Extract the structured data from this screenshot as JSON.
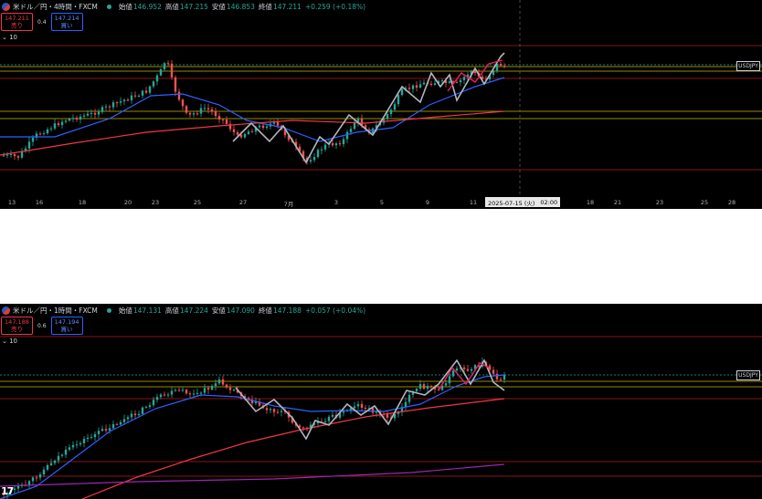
{
  "top": {
    "symbol_title": "米ドル／円・4時間・FXCM",
    "ohlc": [
      {
        "k": "始値",
        "v": "146.952"
      },
      {
        "k": "高値",
        "v": "147.215"
      },
      {
        "k": "安値",
        "v": "146.853"
      },
      {
        "k": "終値",
        "v": "147.211"
      },
      {
        "k": "",
        "v": "+0.259 (+0.18%)"
      }
    ],
    "sell_price": "147.211",
    "sell_label": "売り",
    "spread": "0.4",
    "buy_price": "147.214",
    "buy_label": "買い",
    "indicator_toggle": "⌄ 10",
    "price_tag": "USDJPY",
    "x_labels": [
      "13",
      "16",
      "18",
      "20",
      "23",
      "25",
      "27",
      "7月",
      "3",
      "5",
      "9",
      "11",
      "18",
      "21",
      "23",
      "25",
      "28"
    ],
    "crosshair_date": "2025-07-15 (火)",
    "crosshair_time": "02:00"
  },
  "bottom": {
    "symbol_title": "米ドル／円・1時間・FXCM",
    "ohlc": [
      {
        "k": "始値",
        "v": "147.131"
      },
      {
        "k": "高値",
        "v": "147.224"
      },
      {
        "k": "安値",
        "v": "147.090"
      },
      {
        "k": "終値",
        "v": "147.188"
      },
      {
        "k": "",
        "v": "+0.057 (+0.04%)"
      }
    ],
    "sell_price": "147.188",
    "sell_label": "売り",
    "spread": "0.6",
    "buy_price": "147.194",
    "buy_label": "買い",
    "indicator_toggle": "⌄ 10",
    "price_tag": "USDJPY",
    "logo_text": "17"
  },
  "colors": {
    "background": "#000000",
    "bull": "#26a69a",
    "bear": "#ef5350",
    "fast_ma": "#2962ff",
    "slow_ma": "#f23645",
    "long_ma": "#9c27b0",
    "zigzag": "#b2b5be",
    "level_red": "#b71c1c",
    "level_yellow": "#c8b400"
  }
}
